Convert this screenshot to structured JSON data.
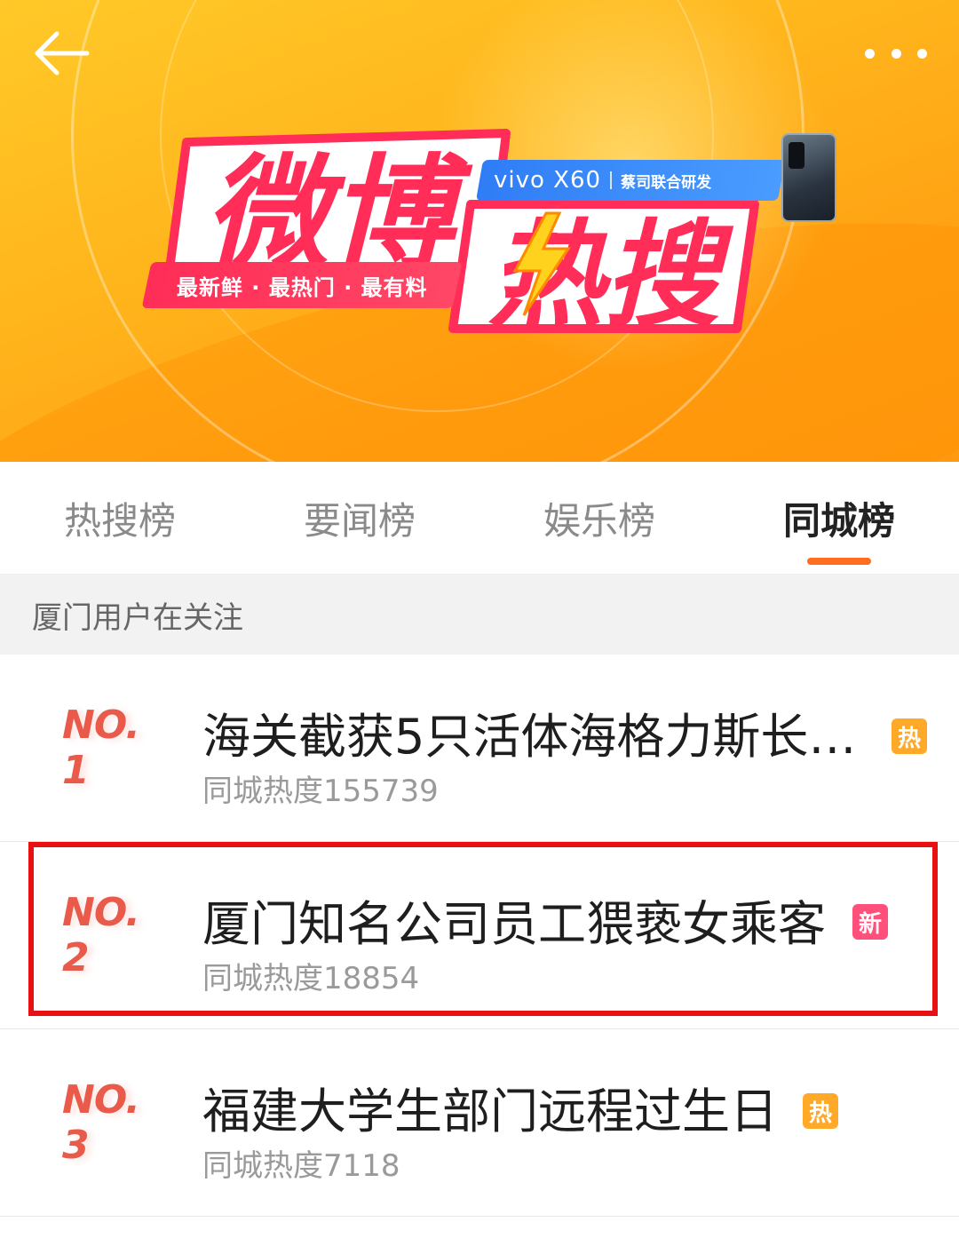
{
  "banner": {
    "logo_text_1": "微博",
    "logo_text_2": "热搜",
    "slogan": "最新鲜 · 最热门 · 最有料",
    "sponsor_brand": "vivo X60",
    "sponsor_sub": "蔡司联合研发",
    "back_icon": "arrow-left-icon",
    "more_icon": "more-dots-icon"
  },
  "tabs": [
    {
      "label": "热搜榜",
      "active": false
    },
    {
      "label": "要闻榜",
      "active": false
    },
    {
      "label": "娱乐榜",
      "active": false
    },
    {
      "label": "同城榜",
      "active": true
    }
  ],
  "section": {
    "title": "厦门用户在关注"
  },
  "items": [
    {
      "rank": "NO. 1",
      "title": "海关截获5只活体海格力斯长…",
      "heat": "同城热度155739",
      "badge": "热",
      "badge_type": "hot"
    },
    {
      "rank": "NO. 2",
      "title": "厦门知名公司员工猥亵女乘客",
      "heat": "同城热度18854",
      "badge": "新",
      "badge_type": "new",
      "highlighted": true
    },
    {
      "rank": "NO. 3",
      "title": "福建大学生部门远程过生日",
      "heat": "同城热度7118",
      "badge": "热",
      "badge_type": "hot"
    }
  ],
  "colors": {
    "accent": "#ff6e1f",
    "rank": "#ea5a4a",
    "hot_badge": "#ffa928",
    "new_badge": "#ff4f7b",
    "highlight_box": "#e81010"
  }
}
